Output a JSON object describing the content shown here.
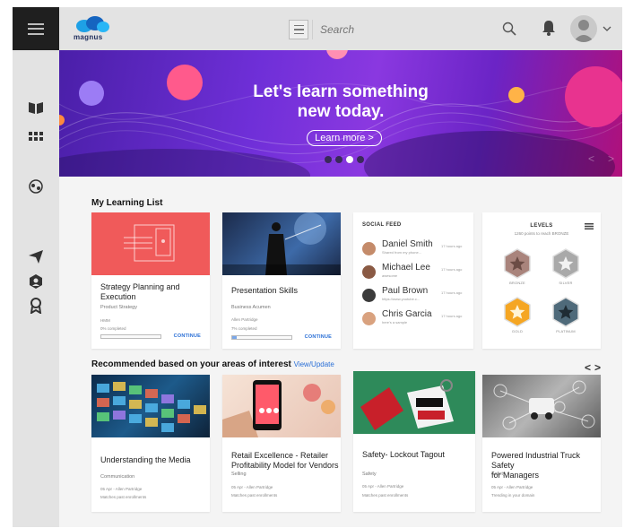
{
  "header": {
    "logo_text": "magnus",
    "search_placeholder": "Search"
  },
  "hero": {
    "title_line1": "Let's learn something",
    "title_line2": "new today.",
    "button_label": "Learn more >",
    "slides": 4,
    "active_slide": 3
  },
  "learning_list": {
    "title": "My Learning List",
    "courses": [
      {
        "title_line1": "Strategy Planning and",
        "title_line2": "Execution",
        "category": "Product Strategy",
        "author": "HMM",
        "progress_text": "0% completed",
        "progress": 0,
        "action": "CONTINUE"
      },
      {
        "title_line1": "Presentation Skills",
        "title_line2": "",
        "category": "Business Acumen",
        "author": "Allen Partridge",
        "progress_text": "7% completed",
        "progress": 0.07,
        "action": "CONTINUE"
      }
    ]
  },
  "social_feed": {
    "title": "SOCIAL FEED",
    "items": [
      {
        "name": "Daniel Smith",
        "text": "Shared from my phone...",
        "time": "17 hours ago"
      },
      {
        "name": "Michael Lee",
        "text": "awesome",
        "time": "17 hours ago"
      },
      {
        "name": "Paul Brown",
        "text": "https://www.youtube.c...",
        "time": "17 hours ago"
      },
      {
        "name": "Chris Garcia",
        "text": "here's a sample",
        "time": "17 hours ago"
      }
    ]
  },
  "levels": {
    "title": "LEVELS",
    "subtitle": "1260 points to reach BRONZE",
    "badges": [
      {
        "label": "BRONZE",
        "color": "#a9847c"
      },
      {
        "label": "SILVER",
        "color": "#a9a9a9"
      },
      {
        "label": "GOLD",
        "color": "#f5a623"
      },
      {
        "label": "PLATINUM",
        "color": "#4f6a7a"
      }
    ]
  },
  "recommended": {
    "title": "Recommended based on your areas of interest",
    "link": "View/Update",
    "courses": [
      {
        "title_line1": "Understanding the Media",
        "title_line2": "",
        "category": "Communication",
        "meta1": "05 Apr - Allen Partridge",
        "meta2": "Matches past enrollments"
      },
      {
        "title_line1": "Retail Excellence - Retailer",
        "title_line2": "Profitability Model for Vendors",
        "category": "Selling",
        "meta1": "05 Apr - Allen Partridge",
        "meta2": "Matches past enrollments"
      },
      {
        "title_line1": "Safety- Lockout Tagout",
        "title_line2": "",
        "category": "Safety",
        "meta1": "05 Apr - Allen Partridge",
        "meta2": "Matches past enrollments"
      },
      {
        "title_line1": "Powered Industrial Truck Safety",
        "title_line2": "for Managers",
        "category": "Safety",
        "meta1": "05 Apr - Allen Partridge",
        "meta2": "Trending in your domain"
      }
    ]
  },
  "icons": {
    "rail": [
      "book-icon",
      "apps-grid-icon",
      "globe-people-icon",
      "send-icon",
      "hexagon-badge-icon",
      "award-icon"
    ]
  },
  "colors": {
    "accent_blue": "#2a6fd6",
    "hero_purple": "#6f2fd8",
    "strategy_card_red": "#f05a5a"
  }
}
